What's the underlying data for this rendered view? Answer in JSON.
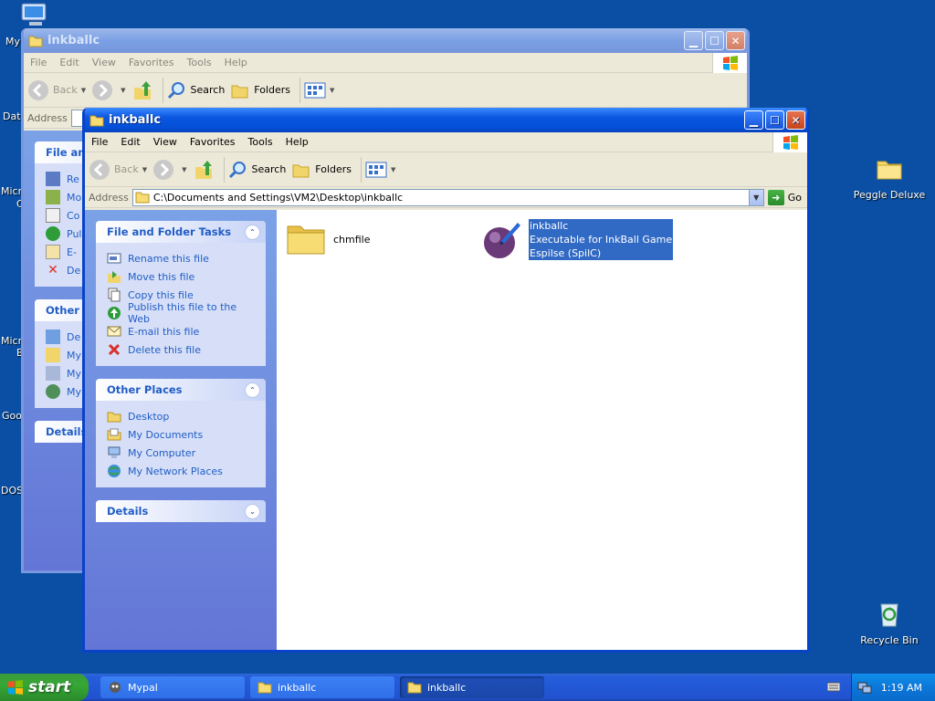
{
  "desktop": {
    "left_labels": [
      "My",
      "Dat",
      "Micr",
      "Micr",
      "Goo",
      "DOS"
    ],
    "left_labels_b": [
      "C",
      "B"
    ],
    "icons": {
      "peggle": "Peggle Deluxe",
      "recycle": "Recycle Bin"
    }
  },
  "back_window": {
    "title": "inkballc",
    "menu": [
      "File",
      "Edit",
      "View",
      "Favorites",
      "Tools",
      "Help"
    ],
    "toolbar": {
      "back": "Back",
      "search": "Search",
      "folders": "Folders"
    },
    "address_label": "Address",
    "panels": {
      "file_tasks_title": "File an",
      "file_tasks": [
        "Re",
        "Mo",
        "Co",
        "Pul",
        "E-",
        "De"
      ],
      "other_places_title": "Other",
      "other_places": [
        "De",
        "My",
        "My",
        "My"
      ],
      "details_title": "Details"
    }
  },
  "front_window": {
    "title": "inkballc",
    "menu": [
      "File",
      "Edit",
      "View",
      "Favorites",
      "Tools",
      "Help"
    ],
    "toolbar": {
      "back": "Back",
      "search": "Search",
      "folders": "Folders"
    },
    "address_label": "Address",
    "address_value": "C:\\Documents and Settings\\VM2\\Desktop\\inkballc",
    "go_label": "Go",
    "file_tasks": {
      "title": "File and Folder Tasks",
      "items": [
        "Rename this file",
        "Move this file",
        "Copy this file",
        "Publish this file to the Web",
        "E-mail this file",
        "Delete this file"
      ]
    },
    "other_places": {
      "title": "Other Places",
      "items": [
        "Desktop",
        "My Documents",
        "My Computer",
        "My Network Places"
      ]
    },
    "details": {
      "title": "Details"
    },
    "files": [
      {
        "name": "chmfile"
      },
      {
        "name": "inkballc",
        "desc": "Executable for InkBall Game",
        "company": "Espilse (SpilC)"
      }
    ]
  },
  "taskbar": {
    "start": "start",
    "buttons": [
      "Mypal",
      "inkballc",
      "inkballc"
    ],
    "clock": "1:19 AM"
  },
  "colors": {
    "accent": "#0a56e0",
    "link": "#215dc6",
    "selection": "#316ac5",
    "desktop": "#0a4fa3"
  }
}
